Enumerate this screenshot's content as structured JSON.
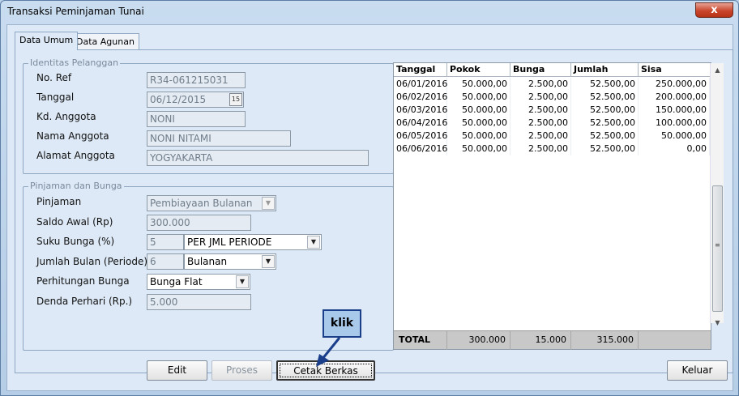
{
  "window": {
    "title": "Transaksi Peminjaman Tunai",
    "close_glyph": "x"
  },
  "tabs": [
    {
      "label": "Data Umum",
      "active": true
    },
    {
      "label": "Data Agunan",
      "active": false
    }
  ],
  "identitas": {
    "group_title": "Identitas Pelanggan",
    "no_ref_label": "No. Ref",
    "no_ref_value": "R34-061215031",
    "tanggal_label": "Tanggal",
    "tanggal_value": "06/12/2015",
    "calendar_glyph": "15",
    "kd_anggota_label": "Kd. Anggota",
    "kd_anggota_value": "NONI",
    "nama_label": "Nama Anggota",
    "nama_value": "NONI NITAMI",
    "alamat_label": "Alamat Anggota",
    "alamat_value": "YOGYAKARTA"
  },
  "pinjaman": {
    "group_title": "Pinjaman dan Bunga",
    "pinjaman_label": "Pinjaman",
    "pinjaman_value": "Pembiayaan Bulanan",
    "saldo_label": "Saldo Awal (Rp)",
    "saldo_value": "300.000",
    "suku_label": "Suku Bunga (%)",
    "suku_value": "5",
    "suku_unit": "PER JML PERIODE",
    "jumlah_label": "Jumlah Bulan (Periode)",
    "jumlah_value": "6",
    "jumlah_unit": "Bulanan",
    "perhitungan_label": "Perhitungan Bunga",
    "perhitungan_value": "Bunga Flat",
    "denda_label": "Denda Perhari (Rp.)",
    "denda_value": "5.000"
  },
  "grid": {
    "headers": [
      "Tanggal",
      "Pokok",
      "Bunga",
      "Jumlah",
      "Sisa"
    ],
    "rows": [
      [
        "06/01/2016",
        "50.000,00",
        "2.500,00",
        "52.500,00",
        "250.000,00"
      ],
      [
        "06/02/2016",
        "50.000,00",
        "2.500,00",
        "52.500,00",
        "200.000,00"
      ],
      [
        "06/03/2016",
        "50.000,00",
        "2.500,00",
        "52.500,00",
        "150.000,00"
      ],
      [
        "06/04/2016",
        "50.000,00",
        "2.500,00",
        "52.500,00",
        "100.000,00"
      ],
      [
        "06/05/2016",
        "50.000,00",
        "2.500,00",
        "52.500,00",
        "50.000,00"
      ],
      [
        "06/06/2016",
        "50.000,00",
        "2.500,00",
        "52.500,00",
        "0,00"
      ]
    ],
    "totals": {
      "label": "TOTAL",
      "pokok": "300.000",
      "bunga": "15.000",
      "jumlah": "315.000"
    }
  },
  "buttons": {
    "edit": "Edit",
    "proses": "Proses",
    "cetak": "Cetak Berkas",
    "keluar": "Keluar"
  },
  "annotation": {
    "text": "klik"
  },
  "colors": {
    "annotation_border": "#1b3e8a",
    "annotation_fill": "#a8c9ea",
    "close_red": "#c9462d"
  }
}
